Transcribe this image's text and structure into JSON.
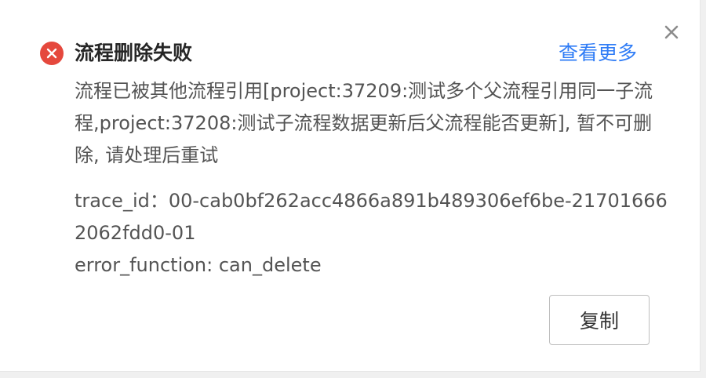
{
  "notification": {
    "status_icon": "error-circle-x-icon",
    "title": "流程删除失败",
    "more_link": "查看更多",
    "close_icon": "close-x-icon",
    "message": "流程已被其他流程引用[project:37209:测试多个父流程引用同一子流程,project:37208:测试子流程数据更新后父流程能否更新], 暂不可删除, 请处理后重试",
    "trace_id": "trace_id：00-cab0bf262acc4866a891b489306ef6be-217016662062fdd0-01",
    "error_function": "error_function: can_delete",
    "copy_button": "复制"
  },
  "colors": {
    "error": "#e5483d",
    "link": "#2f7cf6",
    "title_text": "#262626",
    "body_text": "#545454"
  }
}
